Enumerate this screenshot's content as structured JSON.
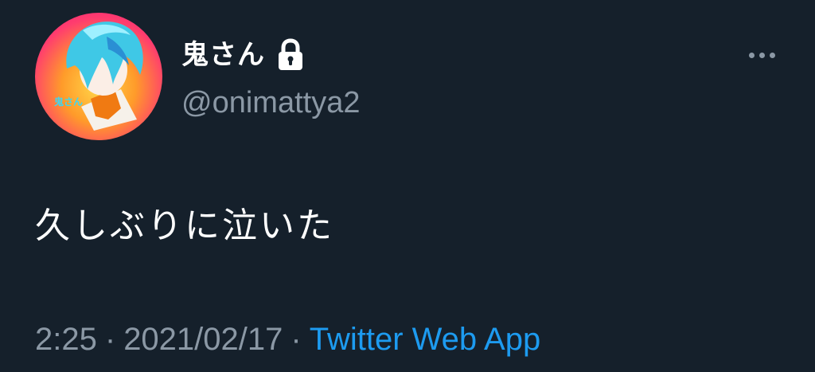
{
  "tweet": {
    "avatar_label": "鬼さん",
    "display_name": "鬼さん",
    "handle": "@onimattya2",
    "protected_icon": "lock-icon",
    "more_icon": "more-horizontal-icon",
    "text": "久しぶりに泣いた",
    "time": "2:25",
    "separator": "·",
    "date": "2021/02/17",
    "source": "Twitter Web App"
  },
  "colors": {
    "background": "#15202b",
    "primary_text": "#ffffff",
    "secondary_text": "#8b98a5",
    "link": "#1d9bf0"
  }
}
